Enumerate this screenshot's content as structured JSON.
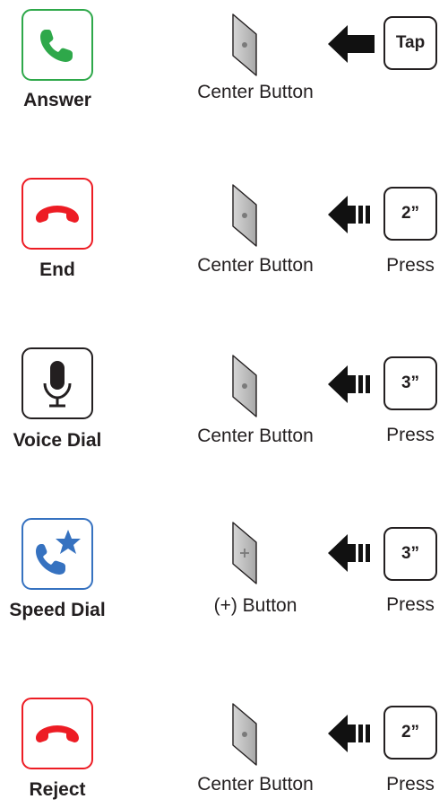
{
  "rows": [
    {
      "action": "Answer",
      "icon": "phone-answer-icon",
      "icon_color": "#2ea84a",
      "button": "Center Button",
      "button_type": "center",
      "arrow": "solid-arrow",
      "key": "Tap",
      "press": ""
    },
    {
      "action": "End",
      "icon": "phone-hangup-icon",
      "icon_color": "#ed1c24",
      "button": "Center Button",
      "button_type": "center",
      "arrow": "hold-arrow",
      "key": "2”",
      "press": "Press"
    },
    {
      "action": "Voice Dial",
      "icon": "microphone-icon",
      "icon_color": "#231f20",
      "button": "Center Button",
      "button_type": "center",
      "arrow": "hold-arrow",
      "key": "3”",
      "press": "Press"
    },
    {
      "action": "Speed Dial",
      "icon": "phone-star-icon",
      "icon_color": "#3672c0",
      "button": "(+) Button",
      "button_type": "plus",
      "arrow": "hold-arrow",
      "key": "3”",
      "press": "Press"
    },
    {
      "action": "Reject",
      "icon": "phone-hangup-icon",
      "icon_color": "#ed1c24",
      "button": "Center Button",
      "button_type": "center",
      "arrow": "hold-arrow",
      "key": "2”",
      "press": "Press"
    }
  ]
}
